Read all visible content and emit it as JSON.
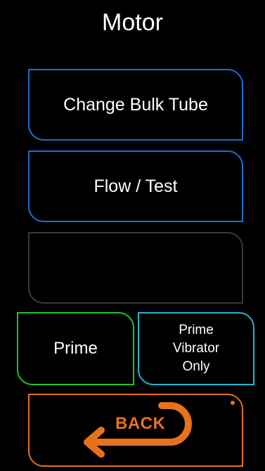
{
  "screen": {
    "title": "Motor"
  },
  "buttons": {
    "change_bulk_tube": "Change Bulk Tube",
    "flow_test": "Flow / Test",
    "empty": "",
    "prime": "Prime",
    "prime_vibrator_only": "Prime\nVibrator\nOnly",
    "back": "BACK"
  },
  "colors": {
    "background": "#000000",
    "accent_blue": "#1a6fd6",
    "disabled_gray": "#3a3a3a",
    "prime_green": "#22c22a",
    "vibrator_cyan": "#22b8d4",
    "back_orange": "#e8711c"
  },
  "icons": {
    "back": "u-turn-back-arrow-icon"
  }
}
